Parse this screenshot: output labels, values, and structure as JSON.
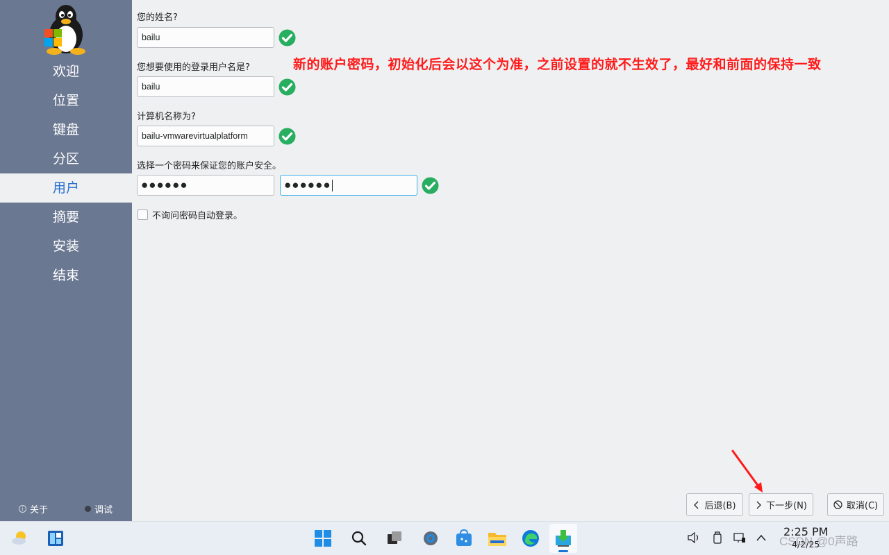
{
  "sidebar": {
    "items": [
      {
        "label": "欢迎"
      },
      {
        "label": "位置"
      },
      {
        "label": "键盘"
      },
      {
        "label": "分区"
      },
      {
        "label": "用户"
      },
      {
        "label": "摘要"
      },
      {
        "label": "安装"
      },
      {
        "label": "结束"
      }
    ],
    "active_index": 4,
    "about_label": "关于",
    "debug_label": "调试"
  },
  "form": {
    "name_label": "您的姓名?",
    "name_value": "bailu",
    "username_label": "您想要使用的登录用户名是?",
    "username_value": "bailu",
    "hostname_label": "计算机名称为?",
    "hostname_value": "bailu-vmwarevirtualplatform",
    "password_label": "选择一个密码来保证您的账户安全。",
    "password_value": "●●●●●●",
    "password_confirm_value": "●●●●●●",
    "autologin_label": "不询问密码自动登录。",
    "autologin_checked": false
  },
  "annotation": {
    "text": "新的账户密码，初始化后会以这个为准，之前设置的就不生效了，最好和前面的保持一致"
  },
  "buttons": {
    "back_label": "后退(B)",
    "next_label": "下一步(N)",
    "cancel_label": "取消(C)"
  },
  "taskbar": {
    "time": "2:25 PM",
    "date": "4/2/25",
    "watermark": "CSDN @0声路"
  },
  "colors": {
    "sidebar_bg": "#6b7891",
    "active_text": "#2a6fd0",
    "check_green": "#27ae60",
    "annotation_red": "#ff1a1a",
    "focus_border": "#3daee9"
  }
}
